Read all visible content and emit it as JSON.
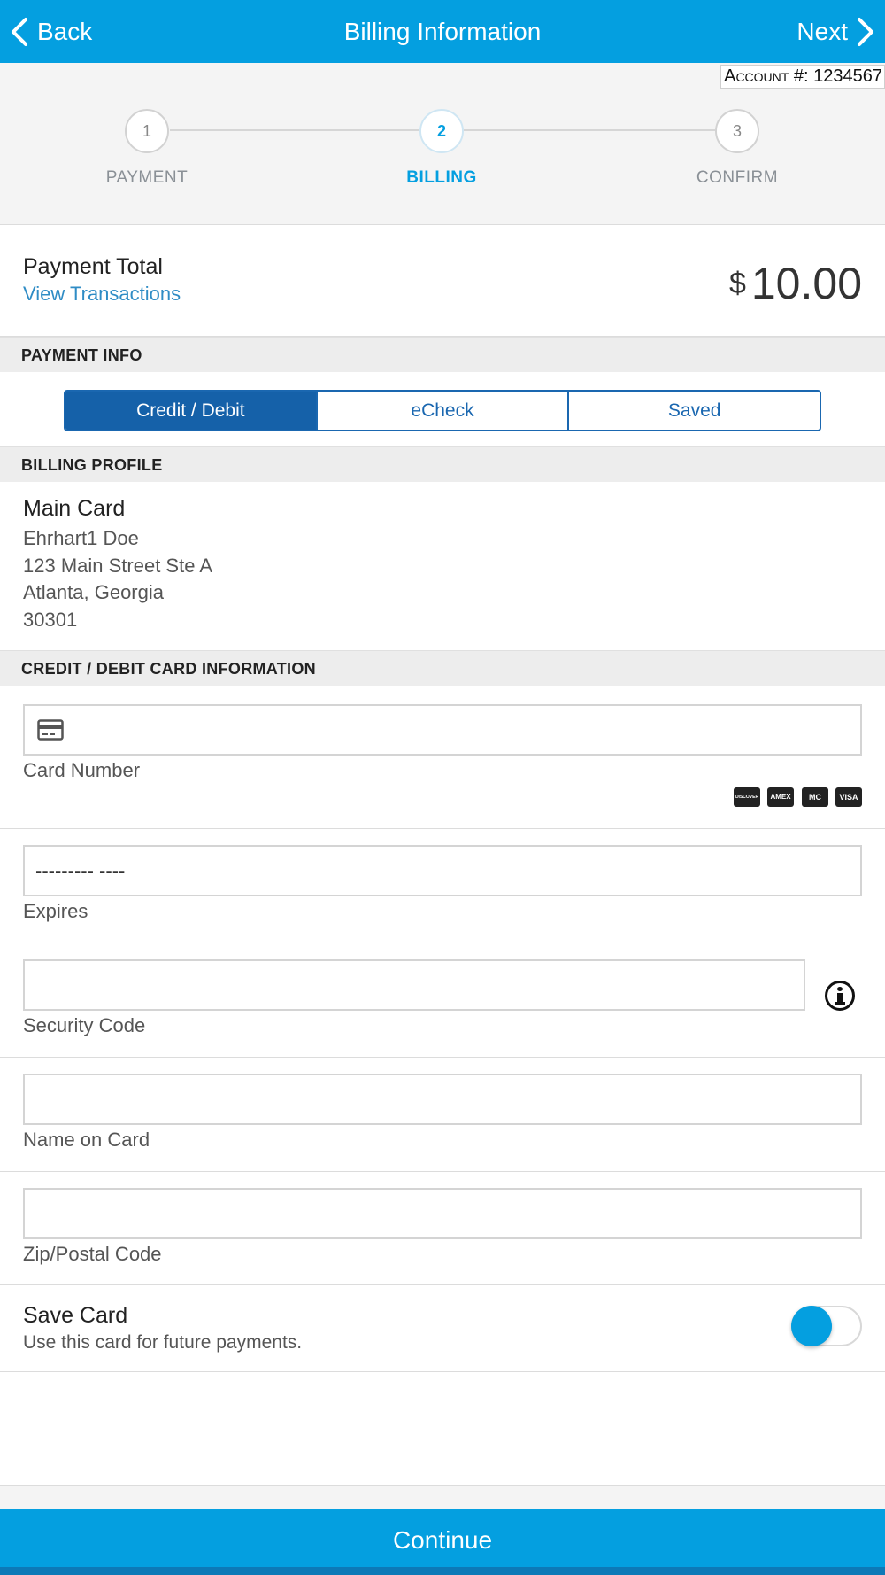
{
  "header": {
    "back_label": "Back",
    "title": "Billing Information",
    "next_label": "Next",
    "bg_color": "#049fe0"
  },
  "account": {
    "text": "Account #: 1234567"
  },
  "stepper": {
    "steps": [
      {
        "number": "1",
        "label": "PAYMENT",
        "active": false
      },
      {
        "number": "2",
        "label": "BILLING",
        "active": true
      },
      {
        "number": "3",
        "label": "CONFIRM",
        "active": false
      }
    ]
  },
  "payment_total": {
    "label": "Payment Total",
    "link": "View Transactions",
    "currency": "$",
    "amount": "10.00"
  },
  "sections": {
    "payment_info": "PAYMENT INFO",
    "billing_profile": "BILLING PROFILE",
    "card_info": "CREDIT / DEBIT CARD INFORMATION"
  },
  "payment_type": {
    "options": [
      "Credit / Debit",
      "eCheck",
      "Saved"
    ],
    "selected": "Credit / Debit"
  },
  "billing_profile": {
    "name": "Main Card",
    "lines": [
      "Ehrhart1 Doe",
      "123 Main Street Ste A",
      "Atlanta, Georgia",
      "30301"
    ]
  },
  "card_form": {
    "card_number_label": "Card Number",
    "card_number_value": "",
    "brands": [
      "DISCOVER",
      "AMEX",
      "MC",
      "VISA"
    ],
    "expires_label": "Expires",
    "expires_value": "--------- ----",
    "security_label": "Security Code",
    "security_value": "",
    "name_label": "Name on Card",
    "name_value": "",
    "zip_label": "Zip/Postal Code",
    "zip_value": ""
  },
  "save_card": {
    "title": "Save Card",
    "subtitle": "Use this card for future payments.",
    "enabled": true
  },
  "footer": {
    "continue_label": "Continue"
  }
}
